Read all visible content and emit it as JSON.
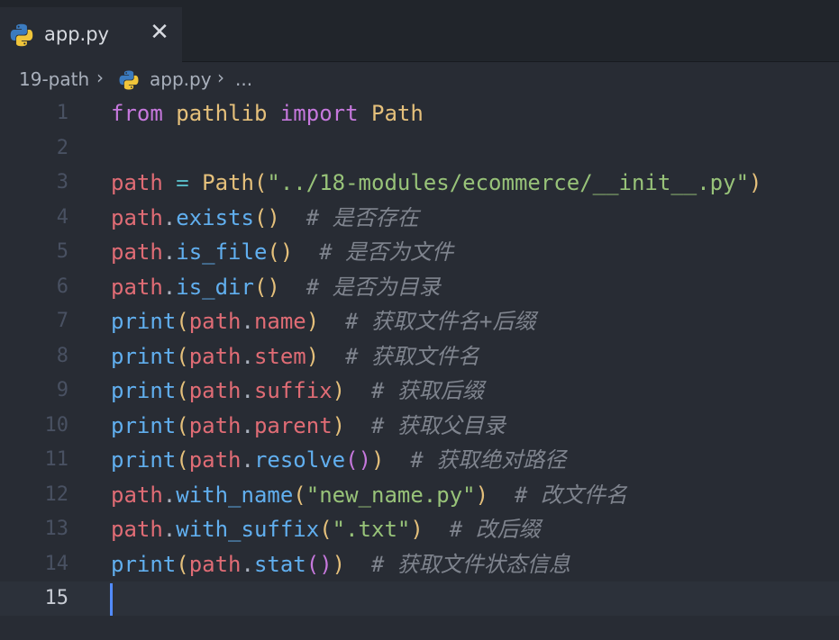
{
  "tab": {
    "label": "app.py",
    "close_glyph": "✕",
    "icon": "python-icon"
  },
  "breadcrumb": {
    "folder": "19-path",
    "file": "app.py",
    "more": "...",
    "sep": "›"
  },
  "editor": {
    "language": "python",
    "current_line": 15,
    "lines": [
      {
        "n": "1"
      },
      {
        "n": "2"
      },
      {
        "n": "3"
      },
      {
        "n": "4"
      },
      {
        "n": "5"
      },
      {
        "n": "6"
      },
      {
        "n": "7"
      },
      {
        "n": "8"
      },
      {
        "n": "9"
      },
      {
        "n": "10"
      },
      {
        "n": "11"
      },
      {
        "n": "12"
      },
      {
        "n": "13"
      },
      {
        "n": "14"
      },
      {
        "n": "15"
      }
    ],
    "tokens": {
      "from": "from",
      "pathlib": "pathlib",
      "import": "import",
      "Path": "Path",
      "path": "path",
      "eq": "=",
      "dot": ".",
      "lp": "(",
      "rp": ")",
      "print": "print",
      "str_init": "\"../18-modules/ecommerce/__init__.py\"",
      "str_new": "\"new_name.py\"",
      "str_txt": "\".txt\"",
      "exists": "exists",
      "is_file": "is_file",
      "is_dir": "is_dir",
      "name": "name",
      "stem": "stem",
      "suffix": "suffix",
      "parent": "parent",
      "resolve": "resolve",
      "with_name": "with_name",
      "with_suffix": "with_suffix",
      "stat": "stat"
    },
    "comments": {
      "c4": "# 是否存在",
      "c5": "# 是否为文件",
      "c6": "# 是否为目录",
      "c7": "# 获取文件名+后缀",
      "c8": "# 获取文件名",
      "c9": "# 获取后缀",
      "c10": "# 获取父目录",
      "c11": "# 获取绝对路径",
      "c12": "# 改文件名",
      "c13": "# 改后缀",
      "c14": "# 获取文件状态信息"
    }
  },
  "colors": {
    "background": "#282c34",
    "tabbar": "#21252b",
    "keyword": "#c678dd",
    "class": "#e5c07b",
    "variable": "#e06c75",
    "function": "#61afef",
    "string": "#98c379",
    "comment": "#7f848e",
    "cursor": "#528bff"
  }
}
